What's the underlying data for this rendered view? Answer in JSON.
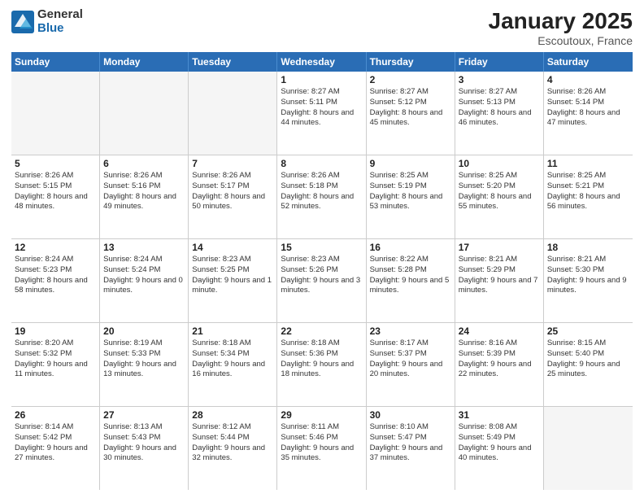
{
  "logo": {
    "general": "General",
    "blue": "Blue"
  },
  "title": "January 2025",
  "location": "Escoutoux, France",
  "header_days": [
    "Sunday",
    "Monday",
    "Tuesday",
    "Wednesday",
    "Thursday",
    "Friday",
    "Saturday"
  ],
  "weeks": [
    [
      {
        "day": "",
        "text": ""
      },
      {
        "day": "",
        "text": ""
      },
      {
        "day": "",
        "text": ""
      },
      {
        "day": "1",
        "text": "Sunrise: 8:27 AM\nSunset: 5:11 PM\nDaylight: 8 hours and 44 minutes."
      },
      {
        "day": "2",
        "text": "Sunrise: 8:27 AM\nSunset: 5:12 PM\nDaylight: 8 hours and 45 minutes."
      },
      {
        "day": "3",
        "text": "Sunrise: 8:27 AM\nSunset: 5:13 PM\nDaylight: 8 hours and 46 minutes."
      },
      {
        "day": "4",
        "text": "Sunrise: 8:26 AM\nSunset: 5:14 PM\nDaylight: 8 hours and 47 minutes."
      }
    ],
    [
      {
        "day": "5",
        "text": "Sunrise: 8:26 AM\nSunset: 5:15 PM\nDaylight: 8 hours and 48 minutes."
      },
      {
        "day": "6",
        "text": "Sunrise: 8:26 AM\nSunset: 5:16 PM\nDaylight: 8 hours and 49 minutes."
      },
      {
        "day": "7",
        "text": "Sunrise: 8:26 AM\nSunset: 5:17 PM\nDaylight: 8 hours and 50 minutes."
      },
      {
        "day": "8",
        "text": "Sunrise: 8:26 AM\nSunset: 5:18 PM\nDaylight: 8 hours and 52 minutes."
      },
      {
        "day": "9",
        "text": "Sunrise: 8:25 AM\nSunset: 5:19 PM\nDaylight: 8 hours and 53 minutes."
      },
      {
        "day": "10",
        "text": "Sunrise: 8:25 AM\nSunset: 5:20 PM\nDaylight: 8 hours and 55 minutes."
      },
      {
        "day": "11",
        "text": "Sunrise: 8:25 AM\nSunset: 5:21 PM\nDaylight: 8 hours and 56 minutes."
      }
    ],
    [
      {
        "day": "12",
        "text": "Sunrise: 8:24 AM\nSunset: 5:23 PM\nDaylight: 8 hours and 58 minutes."
      },
      {
        "day": "13",
        "text": "Sunrise: 8:24 AM\nSunset: 5:24 PM\nDaylight: 9 hours and 0 minutes."
      },
      {
        "day": "14",
        "text": "Sunrise: 8:23 AM\nSunset: 5:25 PM\nDaylight: 9 hours and 1 minute."
      },
      {
        "day": "15",
        "text": "Sunrise: 8:23 AM\nSunset: 5:26 PM\nDaylight: 9 hours and 3 minutes."
      },
      {
        "day": "16",
        "text": "Sunrise: 8:22 AM\nSunset: 5:28 PM\nDaylight: 9 hours and 5 minutes."
      },
      {
        "day": "17",
        "text": "Sunrise: 8:21 AM\nSunset: 5:29 PM\nDaylight: 9 hours and 7 minutes."
      },
      {
        "day": "18",
        "text": "Sunrise: 8:21 AM\nSunset: 5:30 PM\nDaylight: 9 hours and 9 minutes."
      }
    ],
    [
      {
        "day": "19",
        "text": "Sunrise: 8:20 AM\nSunset: 5:32 PM\nDaylight: 9 hours and 11 minutes."
      },
      {
        "day": "20",
        "text": "Sunrise: 8:19 AM\nSunset: 5:33 PM\nDaylight: 9 hours and 13 minutes."
      },
      {
        "day": "21",
        "text": "Sunrise: 8:18 AM\nSunset: 5:34 PM\nDaylight: 9 hours and 16 minutes."
      },
      {
        "day": "22",
        "text": "Sunrise: 8:18 AM\nSunset: 5:36 PM\nDaylight: 9 hours and 18 minutes."
      },
      {
        "day": "23",
        "text": "Sunrise: 8:17 AM\nSunset: 5:37 PM\nDaylight: 9 hours and 20 minutes."
      },
      {
        "day": "24",
        "text": "Sunrise: 8:16 AM\nSunset: 5:39 PM\nDaylight: 9 hours and 22 minutes."
      },
      {
        "day": "25",
        "text": "Sunrise: 8:15 AM\nSunset: 5:40 PM\nDaylight: 9 hours and 25 minutes."
      }
    ],
    [
      {
        "day": "26",
        "text": "Sunrise: 8:14 AM\nSunset: 5:42 PM\nDaylight: 9 hours and 27 minutes."
      },
      {
        "day": "27",
        "text": "Sunrise: 8:13 AM\nSunset: 5:43 PM\nDaylight: 9 hours and 30 minutes."
      },
      {
        "day": "28",
        "text": "Sunrise: 8:12 AM\nSunset: 5:44 PM\nDaylight: 9 hours and 32 minutes."
      },
      {
        "day": "29",
        "text": "Sunrise: 8:11 AM\nSunset: 5:46 PM\nDaylight: 9 hours and 35 minutes."
      },
      {
        "day": "30",
        "text": "Sunrise: 8:10 AM\nSunset: 5:47 PM\nDaylight: 9 hours and 37 minutes."
      },
      {
        "day": "31",
        "text": "Sunrise: 8:08 AM\nSunset: 5:49 PM\nDaylight: 9 hours and 40 minutes."
      },
      {
        "day": "",
        "text": ""
      }
    ]
  ]
}
